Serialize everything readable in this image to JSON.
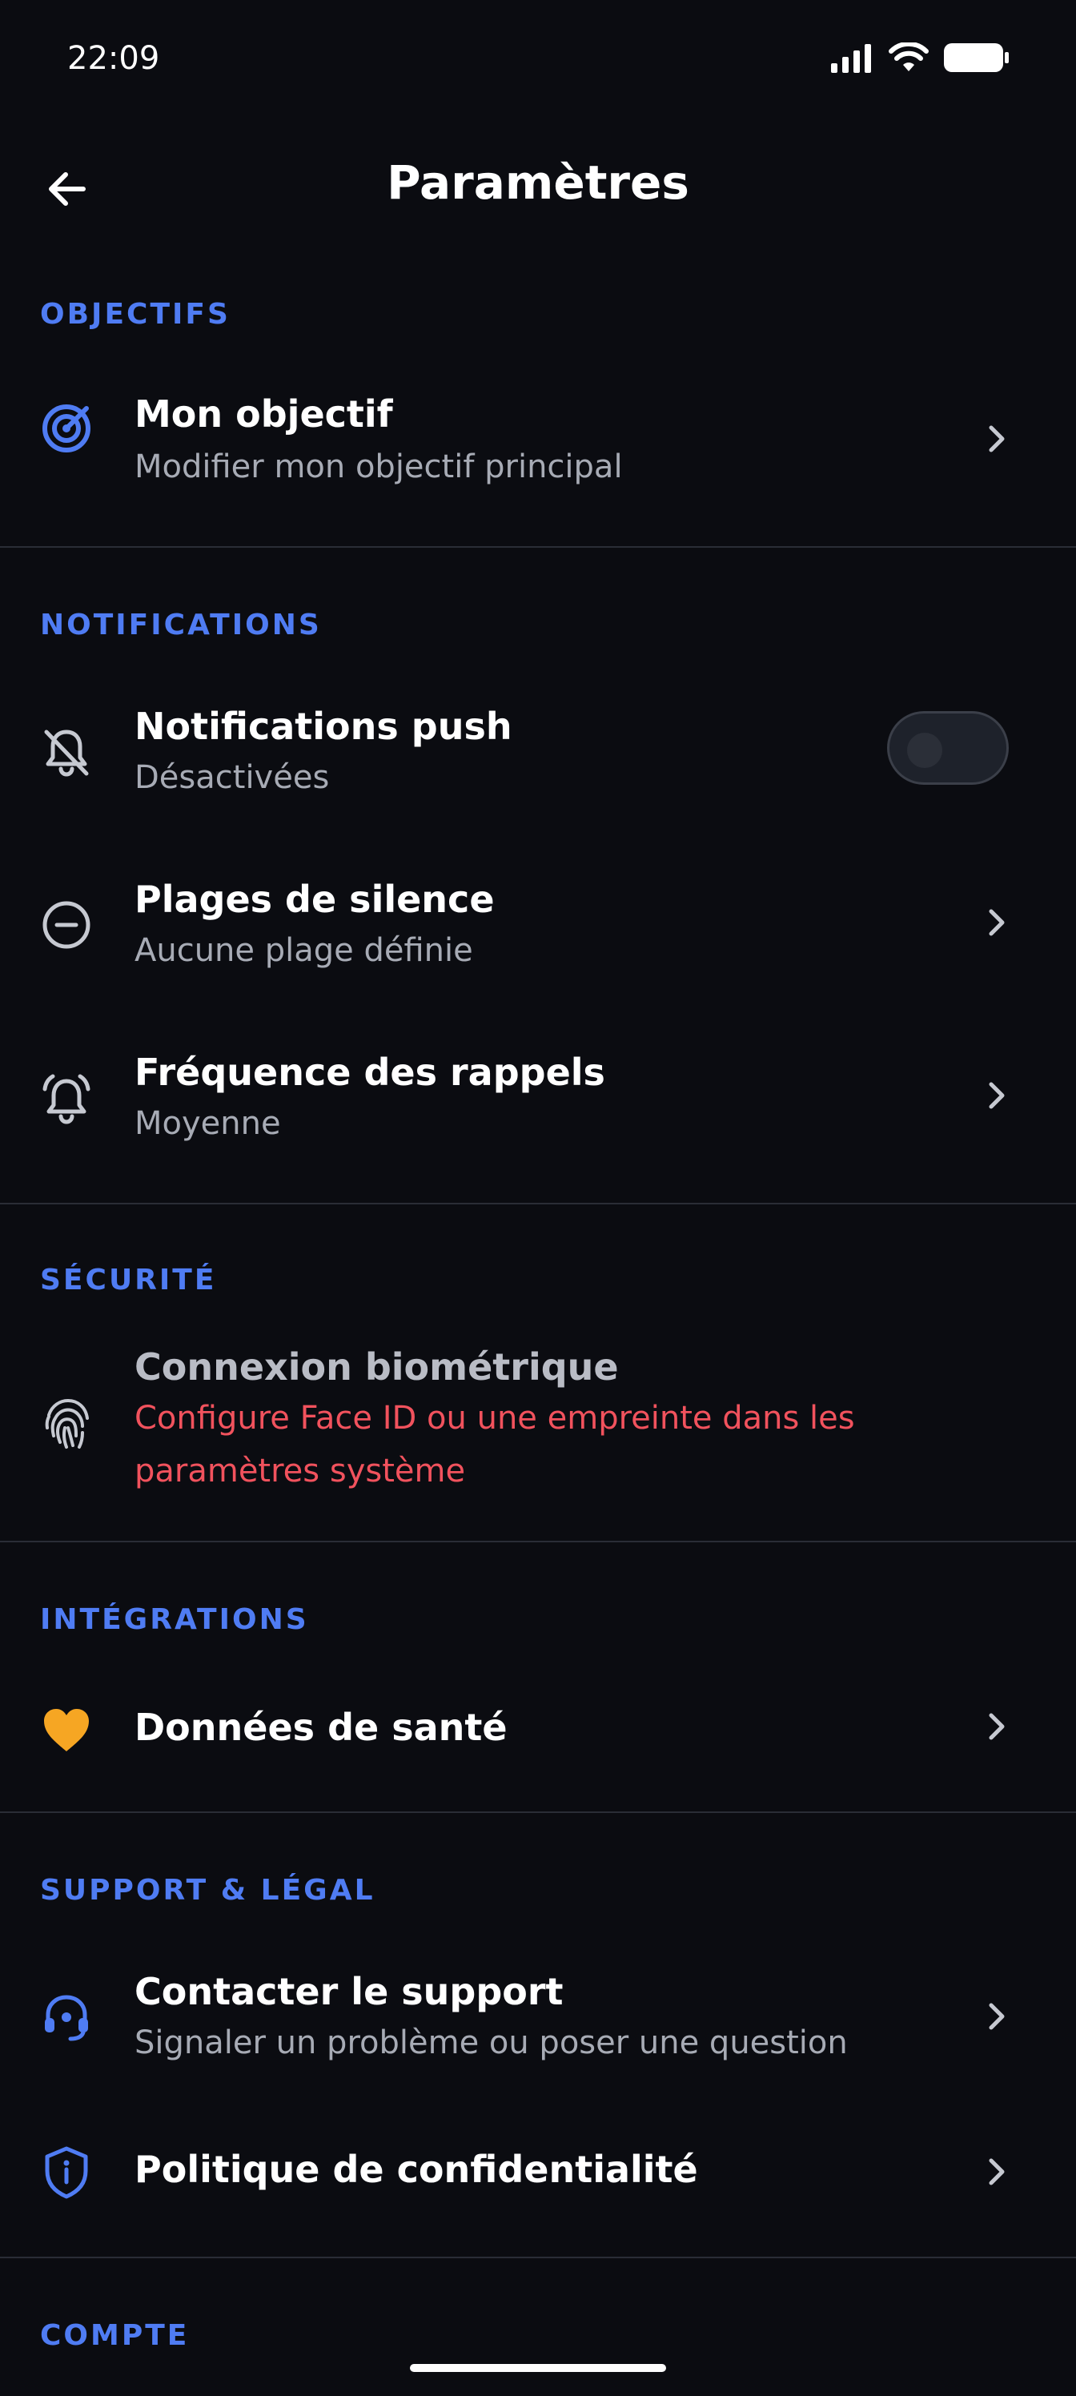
{
  "status_bar": {
    "time": "22:09"
  },
  "header": {
    "title": "Paramètres"
  },
  "sections": {
    "objectifs": {
      "title": "OBJECTIFS",
      "items": [
        {
          "title": "Mon objectif",
          "subtitle": "Modifier mon objectif principal",
          "icon": "target-icon"
        }
      ]
    },
    "notifications": {
      "title": "NOTIFICATIONS",
      "items": [
        {
          "title": "Notifications push",
          "subtitle": "Désactivées",
          "icon": "bell-off-icon",
          "toggle": false
        },
        {
          "title": "Plages de silence",
          "subtitle": "Aucune plage définie",
          "icon": "minus-circle-icon"
        },
        {
          "title": "Fréquence des rappels",
          "subtitle": "Moyenne",
          "icon": "alarm-bell-icon"
        }
      ]
    },
    "securite": {
      "title": "SÉCURITÉ",
      "items": [
        {
          "title": "Connexion biométrique",
          "subtitle_line1": "Configure Face ID ou une empreinte dans les",
          "subtitle_line2": "paramètres système",
          "icon": "fingerprint-icon"
        }
      ]
    },
    "integrations": {
      "title": "INTÉGRATIONS",
      "items": [
        {
          "title": "Données de santé",
          "icon": "heart-icon"
        }
      ]
    },
    "support": {
      "title": "SUPPORT & LÉGAL",
      "items": [
        {
          "title": "Contacter le support",
          "subtitle": "Signaler un problème ou poser une question",
          "icon": "headset-icon"
        },
        {
          "title": "Politique de confidentialité",
          "icon": "shield-info-icon"
        }
      ]
    },
    "compte": {
      "title": "COMPTE"
    }
  },
  "colors": {
    "background": "#0b0c11",
    "accent": "#4f7cf3",
    "error": "#f1525d",
    "heart": "#f6a623"
  }
}
